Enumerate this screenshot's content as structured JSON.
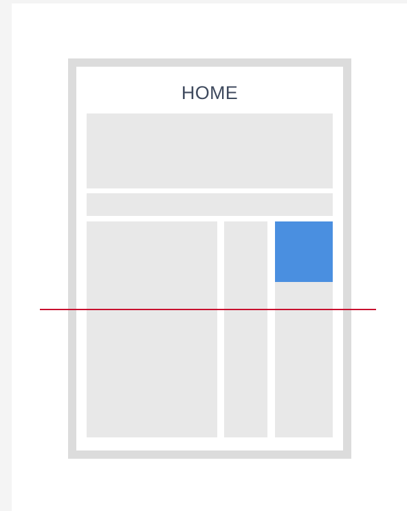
{
  "page": {
    "title": "HOME"
  },
  "colors": {
    "background": "#f4f4f4",
    "frame": "#dcdcdc",
    "block": "#e8e8e8",
    "highlight": "#4a8fe0",
    "fold_line": "#c8102e",
    "title_text": "#3f4a5e"
  }
}
